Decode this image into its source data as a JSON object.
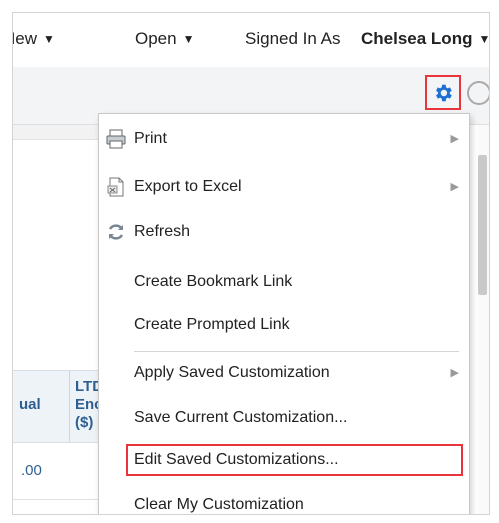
{
  "topbar": {
    "new_label": "New",
    "open_label": "Open",
    "signed_in_as": "Signed In As",
    "user_name": "Chelsea Long"
  },
  "toolbar": {
    "gear_icon": "gear-icon",
    "gear_color": "#1f6fd1",
    "highlight_color": "#e8353b"
  },
  "background": {
    "col_header_1": "ual",
    "col_header_2_line1": "LTD",
    "col_header_2_line2": "Enc",
    "col_header_2_line3": "($)",
    "cell_value": ".00"
  },
  "menu": {
    "items": [
      {
        "label": "Print",
        "icon": "printer-icon",
        "submenu": true
      },
      {
        "label": "Export to Excel",
        "icon": "excel-file-icon",
        "submenu": true
      },
      {
        "label": "Refresh",
        "icon": "refresh-icon",
        "submenu": false
      },
      {
        "label": "Create Bookmark Link",
        "icon": "",
        "submenu": false
      },
      {
        "label": "Create Prompted Link",
        "icon": "",
        "submenu": false
      },
      {
        "label": "Apply Saved Customization",
        "icon": "",
        "submenu": true
      },
      {
        "label": "Save Current Customization...",
        "icon": "",
        "submenu": false
      },
      {
        "label": "Edit Saved Customizations...",
        "icon": "",
        "submenu": false,
        "highlighted": true
      },
      {
        "label": "Clear My Customization",
        "icon": "",
        "submenu": false
      }
    ]
  }
}
